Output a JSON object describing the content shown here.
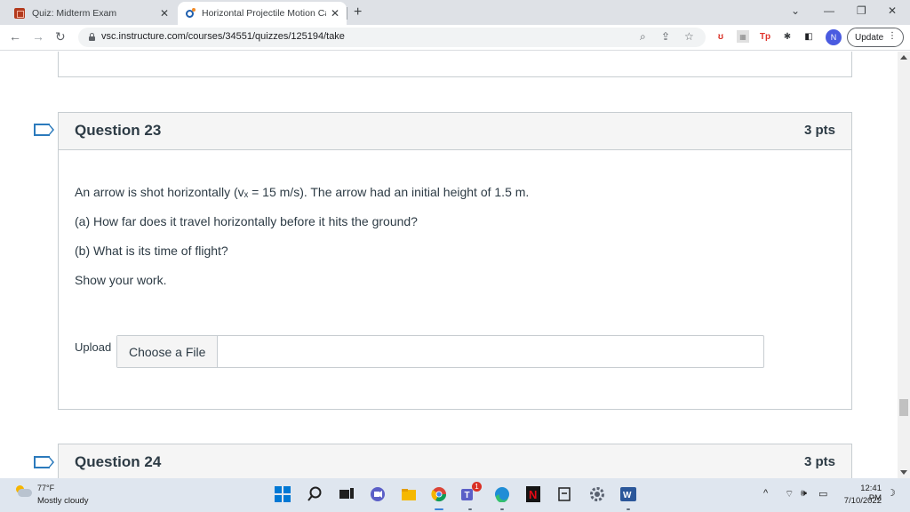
{
  "browser": {
    "tabs": [
      {
        "title": "Quiz: Midterm Exam",
        "active": false,
        "icon": "canvas-icon"
      },
      {
        "title": "Horizontal Projectile Motion Calc",
        "active": true,
        "icon": "calculator-icon"
      }
    ],
    "url": "vsc.instructure.com/courses/34551/quizzes/125194/take",
    "update_label": "Update",
    "profile_initial": "N"
  },
  "questions": [
    {
      "name": "Question 23",
      "points": "3 pts",
      "prompt_lines": [
        "An arrow is shot horizontally (vₓ = 15 m/s). The arrow had an initial height of 1.5 m.",
        "(a) How far does it travel horizontally before it hits the ground?",
        "(b) What is its time of flight?",
        "Show your work."
      ],
      "upload_label": "Upload",
      "choose_file_label": "Choose a File"
    },
    {
      "name": "Question 24",
      "points": "3 pts"
    }
  ],
  "taskbar": {
    "weather_temp": "77°F",
    "weather_desc": "Mostly cloudy",
    "teams_badge": "1",
    "time": "12:41 PM",
    "date": "7/10/2022"
  },
  "colors": {
    "flag": "#2b7abc",
    "header_bg": "#f5f5f5",
    "border": "#c7cdd1",
    "text": "#2d3b45"
  }
}
